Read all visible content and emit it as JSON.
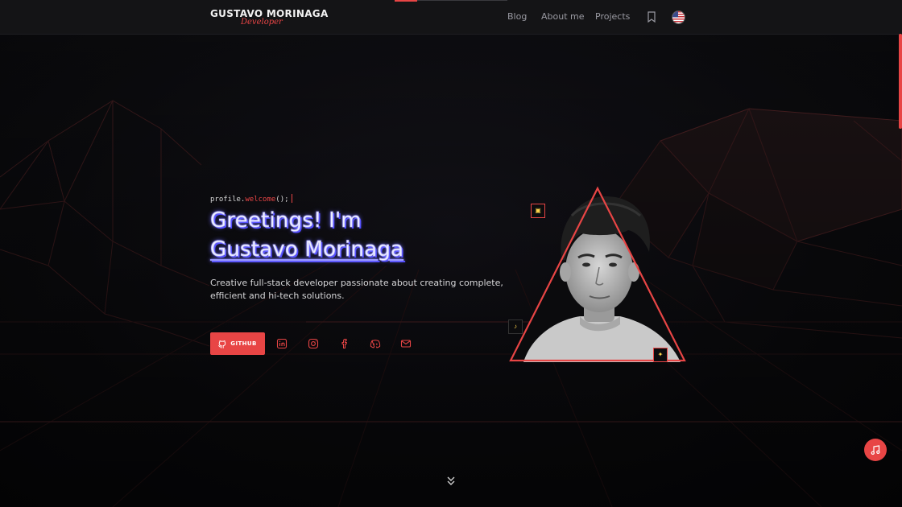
{
  "brand": {
    "name": "GUSTAVO MORINAGA",
    "role": "Developer"
  },
  "nav": {
    "links": [
      "Blog",
      "About me",
      "Projects"
    ],
    "bookmark_icon": "bookmark-icon",
    "language_icon": "us-flag-icon"
  },
  "hero": {
    "code": {
      "object": "profile.",
      "method": "welcome",
      "suffix": "();"
    },
    "headline_line1": "Greetings! I'm",
    "headline_line2": "Gustavo Morinaga",
    "bio": "Creative full-stack developer passionate about creating complete, efficient and hi-tech solutions.",
    "github_label": "GITHUB",
    "socials": [
      "linkedin-icon",
      "instagram-icon",
      "facebook-icon",
      "discord-icon",
      "email-icon"
    ]
  },
  "colors": {
    "accent": "#e84545",
    "header_bg": "#141416",
    "headline_glow": "#6b68ff"
  }
}
